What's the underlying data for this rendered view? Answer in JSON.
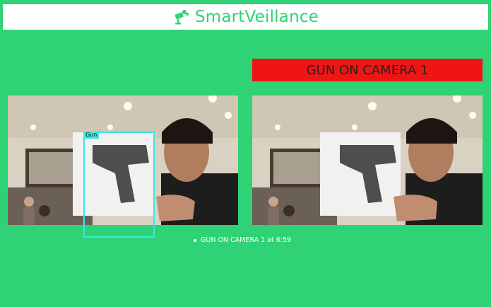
{
  "header": {
    "brand": "SmartVeillance",
    "logo_icon": "security-camera-brain-icon"
  },
  "alert": {
    "text": "GUN ON CAMERA 1",
    "color": "#f01515"
  },
  "detection": {
    "label": "Gun",
    "box_color": "#3ee6e0"
  },
  "events": [
    {
      "text": "GUN ON CAMERA 1 at 6:59"
    }
  ],
  "colors": {
    "background": "#2fd275",
    "accent": "#2fd275"
  }
}
